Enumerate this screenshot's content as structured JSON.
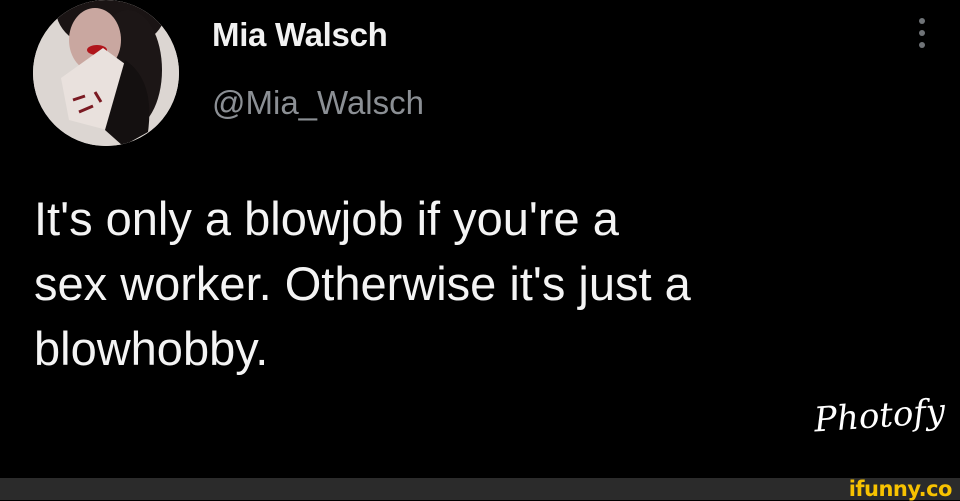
{
  "tweet": {
    "display_name": "Mia Walsch",
    "handle": "@Mia_Walsch",
    "text_lines": [
      "It's only a blowjob if you're a",
      "sex worker. Otherwise it's just a",
      "blowhobby."
    ],
    "avatar_icon": "profile-photo",
    "more_icon": "more-vertical-icon"
  },
  "overlay": {
    "watermark": "Photofy",
    "site_logo": "ifunny.co"
  },
  "colors": {
    "background": "#000000",
    "text": "#f4f4f4",
    "handle": "#8b8f94",
    "ifunny_yellow": "#f7c200"
  }
}
